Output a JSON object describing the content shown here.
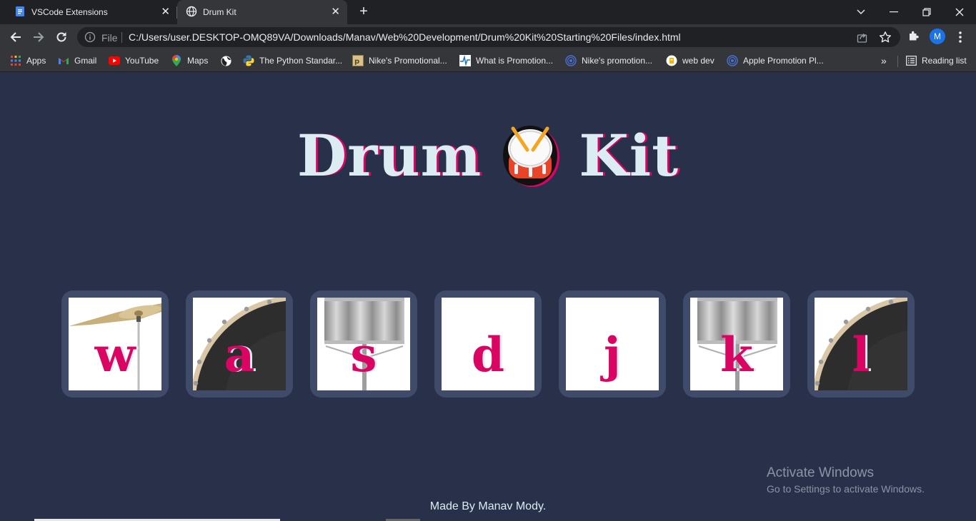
{
  "tabs": [
    {
      "title": "VSCode Extensions",
      "icon": "docs-icon"
    },
    {
      "title": "Drum Kit",
      "icon": "globe-icon"
    }
  ],
  "address": {
    "scheme_label": "File",
    "url": "C:/Users/user.DESKTOP-OMQ89VA/Downloads/Manav/Web%20Development/Drum%20Kit%20Starting%20Files/index.html"
  },
  "profile": {
    "initial": "M"
  },
  "bookmarks": [
    {
      "label": "Apps"
    },
    {
      "label": "Gmail"
    },
    {
      "label": "YouTube"
    },
    {
      "label": "Maps"
    },
    {
      "label": ""
    },
    {
      "label": "The Python Standar..."
    },
    {
      "label": "Nike's Promotional..."
    },
    {
      "label": "What is Promotion..."
    },
    {
      "label": "Nike's promotion..."
    },
    {
      "label": "web dev"
    },
    {
      "label": "Apple Promotion Pl..."
    }
  ],
  "reading_list": "Reading list",
  "page": {
    "title_left": "Drum",
    "title_right": "Kit",
    "drums": [
      {
        "key": "w",
        "art": "crash-cymbal"
      },
      {
        "key": "a",
        "art": "kick-drum"
      },
      {
        "key": "s",
        "art": "snare-drum"
      },
      {
        "key": "d",
        "art": "blank"
      },
      {
        "key": "j",
        "art": "blank"
      },
      {
        "key": "k",
        "art": "snare-drum"
      },
      {
        "key": "l",
        "art": "kick-drum"
      }
    ],
    "footer": "Made By Manav Mody."
  },
  "watermark": {
    "title": "Activate Windows",
    "subtitle": "Go to Settings to activate Windows."
  },
  "colors": {
    "background": "#283149",
    "tile": "#404b69",
    "accent": "#da0463",
    "text": "#dbedf3"
  }
}
